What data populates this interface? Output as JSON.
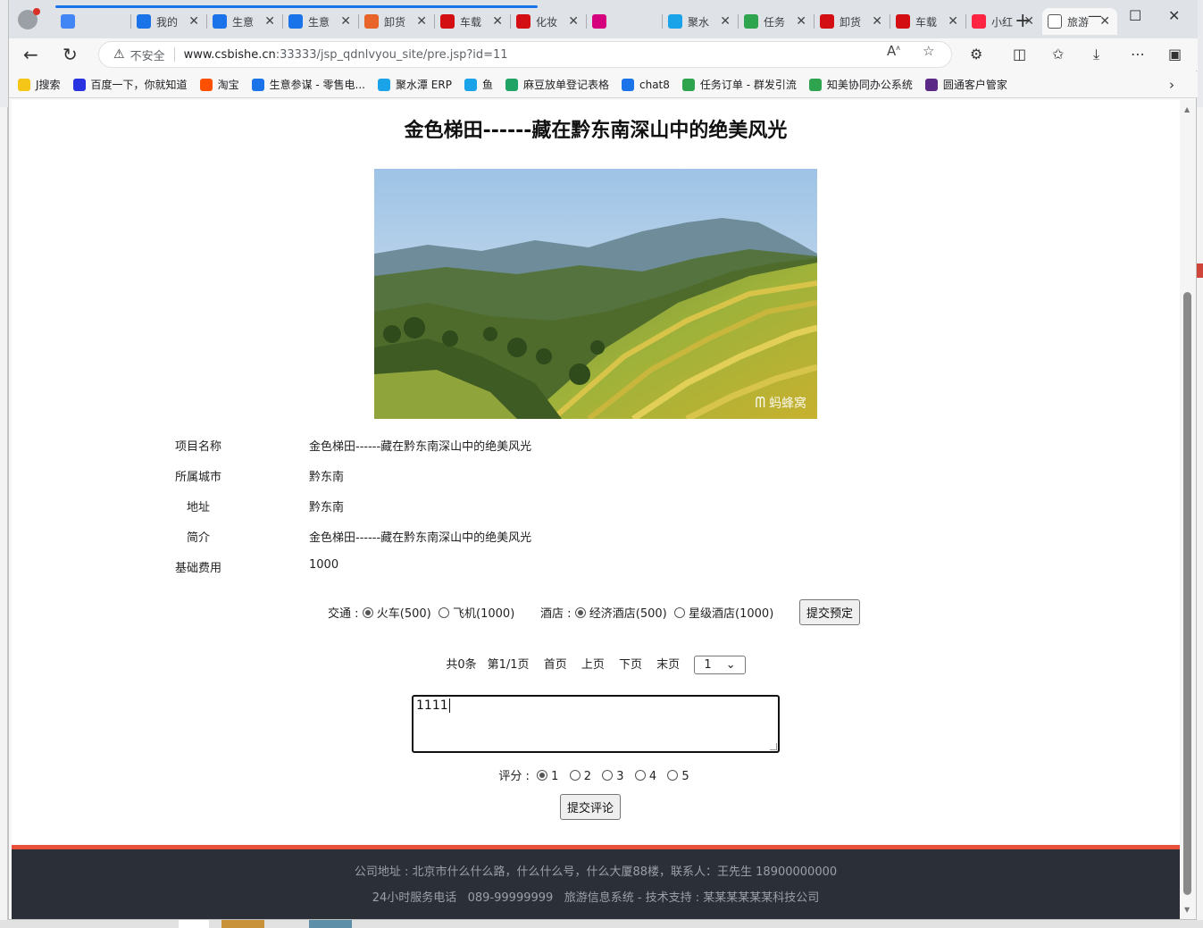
{
  "browser": {
    "tabs": [
      {
        "label": "",
        "color": "#4285f4"
      },
      {
        "label": "我的",
        "color": "#1a73e8"
      },
      {
        "label": "生意",
        "color": "#1a73e8"
      },
      {
        "label": "生意",
        "color": "#1a73e8"
      },
      {
        "label": "卸货",
        "color": "#e8652a"
      },
      {
        "label": "车载",
        "color": "#d40f14"
      },
      {
        "label": "化妆",
        "color": "#d40f14"
      },
      {
        "label": "",
        "color": "#d6007f"
      },
      {
        "label": "聚水",
        "color": "#1aa3e8"
      },
      {
        "label": "任务",
        "color": "#2ea44f"
      },
      {
        "label": "卸货",
        "color": "#d40f14"
      },
      {
        "label": "车载",
        "color": "#d40f14"
      },
      {
        "label": "小红",
        "color": "#ff2442"
      },
      {
        "label": "旅游",
        "color": "#ffffff"
      }
    ],
    "address": {
      "insecure_label": "不安全",
      "host": "www.csbishe.cn",
      "path": ":33333/jsp_qdnlvyou_site/pre.jsp?id=11"
    },
    "bookmarks": [
      {
        "label": "J搜索",
        "color": "#f5c518"
      },
      {
        "label": "百度一下，你就知道",
        "color": "#2932e1"
      },
      {
        "label": "淘宝",
        "color": "#ff5000"
      },
      {
        "label": "生意参谋 - 零售电...",
        "color": "#1a73e8"
      },
      {
        "label": "聚水潭 ERP",
        "color": "#1aa3e8"
      },
      {
        "label": "鱼",
        "color": "#1aa3e8"
      },
      {
        "label": "麻豆放单登记表格",
        "color": "#21a366"
      },
      {
        "label": "chat8",
        "color": "#1a73e8"
      },
      {
        "label": "任务订单 - 群发引流",
        "color": "#2ea44f"
      },
      {
        "label": "知美协同办公系统",
        "color": "#2ea44f"
      },
      {
        "label": "圆通客户管家",
        "color": "#5b2a86"
      }
    ]
  },
  "page": {
    "title": "金色梯田------藏在黔东南深山中的绝美风光",
    "photo_watermark": "蚂蜂窝",
    "info": [
      {
        "key": "项目名称",
        "value": "金色梯田------藏在黔东南深山中的绝美风光"
      },
      {
        "key": "所属城市",
        "value": "黔东南"
      },
      {
        "key": "地址",
        "value": "黔东南"
      },
      {
        "key": "简介",
        "value": "金色梯田------藏在黔东南深山中的绝美风光"
      },
      {
        "key": "基础费用",
        "value": "1000"
      }
    ],
    "booking": {
      "transport_label": "交通 :",
      "transport_options": [
        "火车(500)",
        "飞机(1000)"
      ],
      "transport_selected": "火车(500)",
      "hotel_label": "酒店 :",
      "hotel_options": [
        "经济酒店(500)",
        "星级酒店(1000)"
      ],
      "hotel_selected": "经济酒店(500)",
      "submit_label": "提交预定"
    },
    "pager": {
      "total": "共0条",
      "page_info": "第1/1页",
      "first": "首页",
      "prev": "上页",
      "next": "下页",
      "last": "末页",
      "select_value": "1"
    },
    "comment": {
      "value": "1111",
      "rating_label": "评分 :",
      "rating_options": [
        "1",
        "2",
        "3",
        "4",
        "5"
      ],
      "rating_selected": "1",
      "submit_label": "提交评论"
    },
    "footer": {
      "line1": "公司地址 : 北京市什么什么路，什么什么号，什么大厦88楼，联系人：王先生 18900000000",
      "line2": "24小时服务电话   089-99999999   旅游信息系统 - 技术支持 : 某某某某某某科技公司"
    }
  }
}
